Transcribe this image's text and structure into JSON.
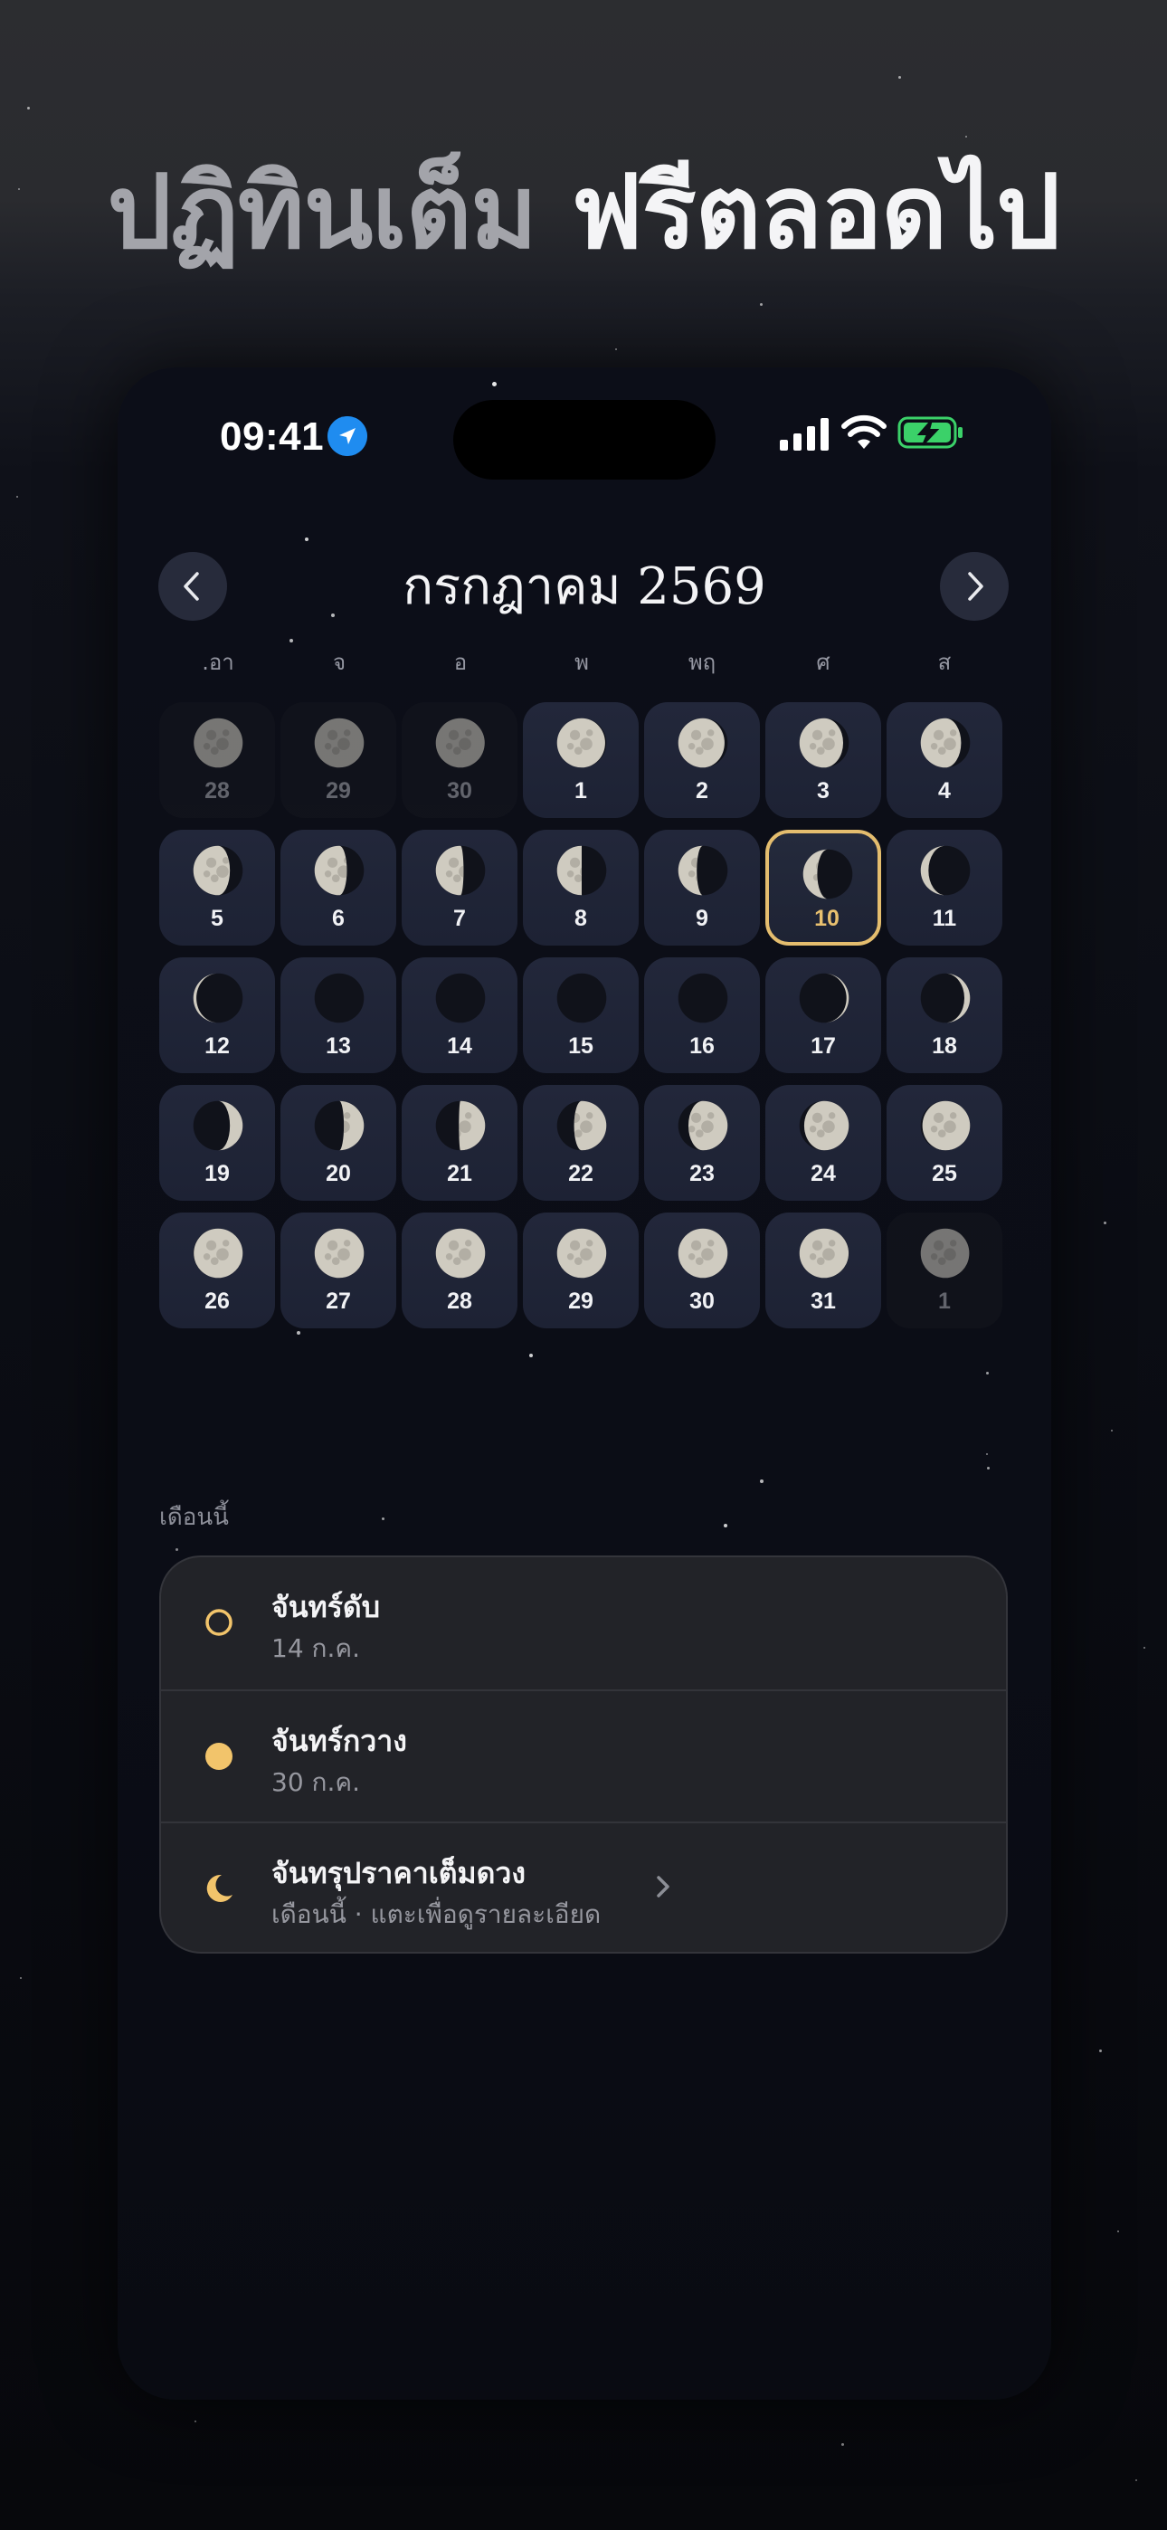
{
  "headline": {
    "part1": "ปฏิทินเต็ม",
    "part2": "ฟรีตลอดไป"
  },
  "status": {
    "time": "09:41"
  },
  "calendar": {
    "title": "กรกฎาคม 2569",
    "weekdays": [
      ".อา",
      "จ",
      "อ",
      "พ",
      "พฤ",
      "ศ",
      "ส"
    ],
    "today": 10,
    "days": [
      {
        "d": "28",
        "out": true,
        "p": 0.47
      },
      {
        "d": "29",
        "out": true,
        "p": 0.5
      },
      {
        "d": "30",
        "out": true,
        "p": 0.53
      },
      {
        "d": "1",
        "out": false,
        "p": 0.55
      },
      {
        "d": "2",
        "out": false,
        "p": 0.58
      },
      {
        "d": "3",
        "out": false,
        "p": 0.61
      },
      {
        "d": "4",
        "out": false,
        "p": 0.64
      },
      {
        "d": "5",
        "out": false,
        "p": 0.67
      },
      {
        "d": "6",
        "out": false,
        "p": 0.7
      },
      {
        "d": "7",
        "out": false,
        "p": 0.73
      },
      {
        "d": "8",
        "out": false,
        "p": 0.75
      },
      {
        "d": "9",
        "out": false,
        "p": 0.79
      },
      {
        "d": "10",
        "out": false,
        "p": 0.82
      },
      {
        "d": "11",
        "out": false,
        "p": 0.87
      },
      {
        "d": "12",
        "out": false,
        "p": 0.92
      },
      {
        "d": "13",
        "out": false,
        "p": 0.97
      },
      {
        "d": "14",
        "out": false,
        "p": 0.0
      },
      {
        "d": "15",
        "out": false,
        "p": 0.02
      },
      {
        "d": "16",
        "out": false,
        "p": 0.04
      },
      {
        "d": "17",
        "out": false,
        "p": 0.07
      },
      {
        "d": "18",
        "out": false,
        "p": 0.11
      },
      {
        "d": "19",
        "out": false,
        "p": 0.17
      },
      {
        "d": "20",
        "out": false,
        "p": 0.22
      },
      {
        "d": "21",
        "out": false,
        "p": 0.26
      },
      {
        "d": "22",
        "out": false,
        "p": 0.3
      },
      {
        "d": "23",
        "out": false,
        "p": 0.35
      },
      {
        "d": "24",
        "out": false,
        "p": 0.4
      },
      {
        "d": "25",
        "out": false,
        "p": 0.44
      },
      {
        "d": "26",
        "out": false,
        "p": 0.47
      },
      {
        "d": "27",
        "out": false,
        "p": 0.49
      },
      {
        "d": "28",
        "out": false,
        "p": 0.5
      },
      {
        "d": "29",
        "out": false,
        "p": 0.51
      },
      {
        "d": "30",
        "out": false,
        "p": 0.5
      },
      {
        "d": "31",
        "out": false,
        "p": 0.52
      },
      {
        "d": "1",
        "out": true,
        "p": 0.54
      }
    ]
  },
  "summary": {
    "label": "เดือนนี้",
    "rows": [
      {
        "title": "จันทร์ดับ",
        "sub": "14 ก.ค.",
        "icon": "new-moon-ring-icon"
      },
      {
        "title": "จันทร์กวาง",
        "sub": "30 ก.ค.",
        "icon": "full-moon-dot-icon"
      },
      {
        "title": "จันทรุปราคาเต็มดวง",
        "sub": "เดือนนี้ · แตะเพื่อดูรายละเอียด",
        "icon": "crescent-moon-icon"
      }
    ]
  },
  "colors": {
    "accent": "#e4bd6e",
    "moon_icon": "#f2c46b",
    "background": "#0b0d16"
  }
}
